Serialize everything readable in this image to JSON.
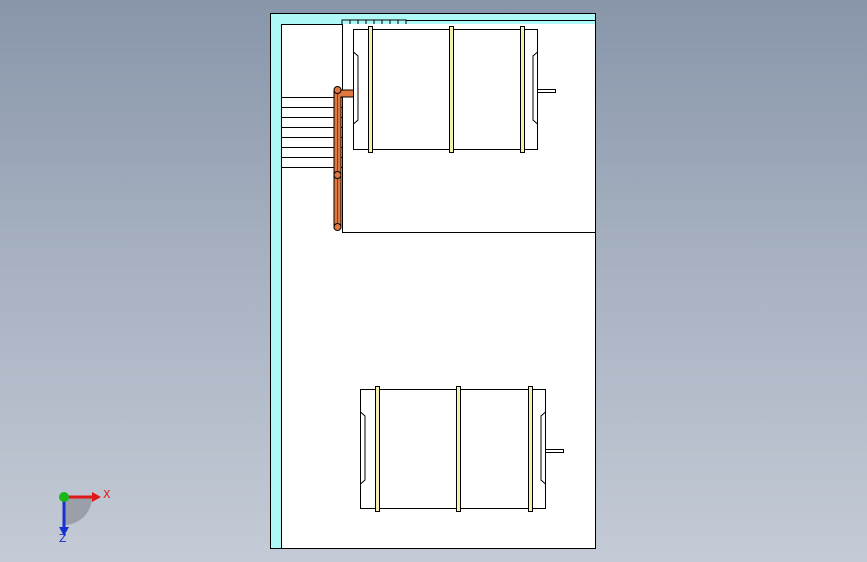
{
  "colors": {
    "sheet_fill": "#ffffff",
    "border_accent": "#aef8f8",
    "outline": "#000000",
    "pipe": "#e07840",
    "band": "#f6f0b0",
    "axis_x": "#e01818",
    "axis_y": "#18b818",
    "axis_z": "#1830d0"
  },
  "triad": {
    "x_label": "X",
    "z_label": "Z"
  }
}
